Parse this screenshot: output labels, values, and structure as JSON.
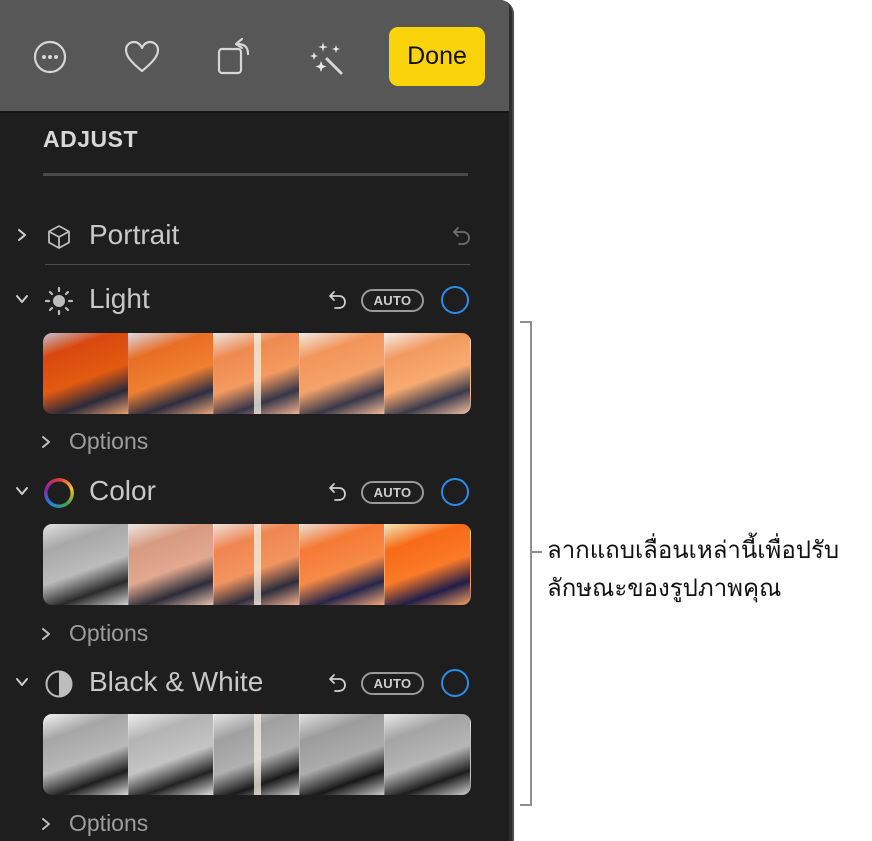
{
  "toolbar": {
    "icons": [
      "more-options-icon",
      "favorite-heart-icon",
      "rotate-icon",
      "auto-enhance-wand-icon"
    ],
    "done_label": "Done",
    "done_color": "#fbd30a"
  },
  "adjust": {
    "title": "ADJUST",
    "sections": [
      {
        "label": "Portrait",
        "icon": "cube-icon",
        "expanded": false,
        "has_auto": false
      },
      {
        "label": "Light",
        "icon": "sun-icon",
        "expanded": true,
        "has_auto": true,
        "auto_label": "AUTO",
        "options_label": "Options",
        "filmstrip": "color-light-variations"
      },
      {
        "label": "Color",
        "icon": "color-wheel-icon",
        "expanded": true,
        "has_auto": true,
        "auto_label": "AUTO",
        "options_label": "Options",
        "filmstrip": "saturation-variations"
      },
      {
        "label": "Black & White",
        "icon": "half-circle-icon",
        "expanded": true,
        "has_auto": true,
        "auto_label": "AUTO",
        "options_label": "Options",
        "filmstrip": "grayscale-variations"
      }
    ],
    "toggle_color": "#2a8cf0",
    "slider_position": 0.5
  },
  "callout": {
    "text": "ลากแถบเลื่อนเหล่านี้เพื่อปรับ\nลักษณะของรูปภาพคุณ"
  }
}
